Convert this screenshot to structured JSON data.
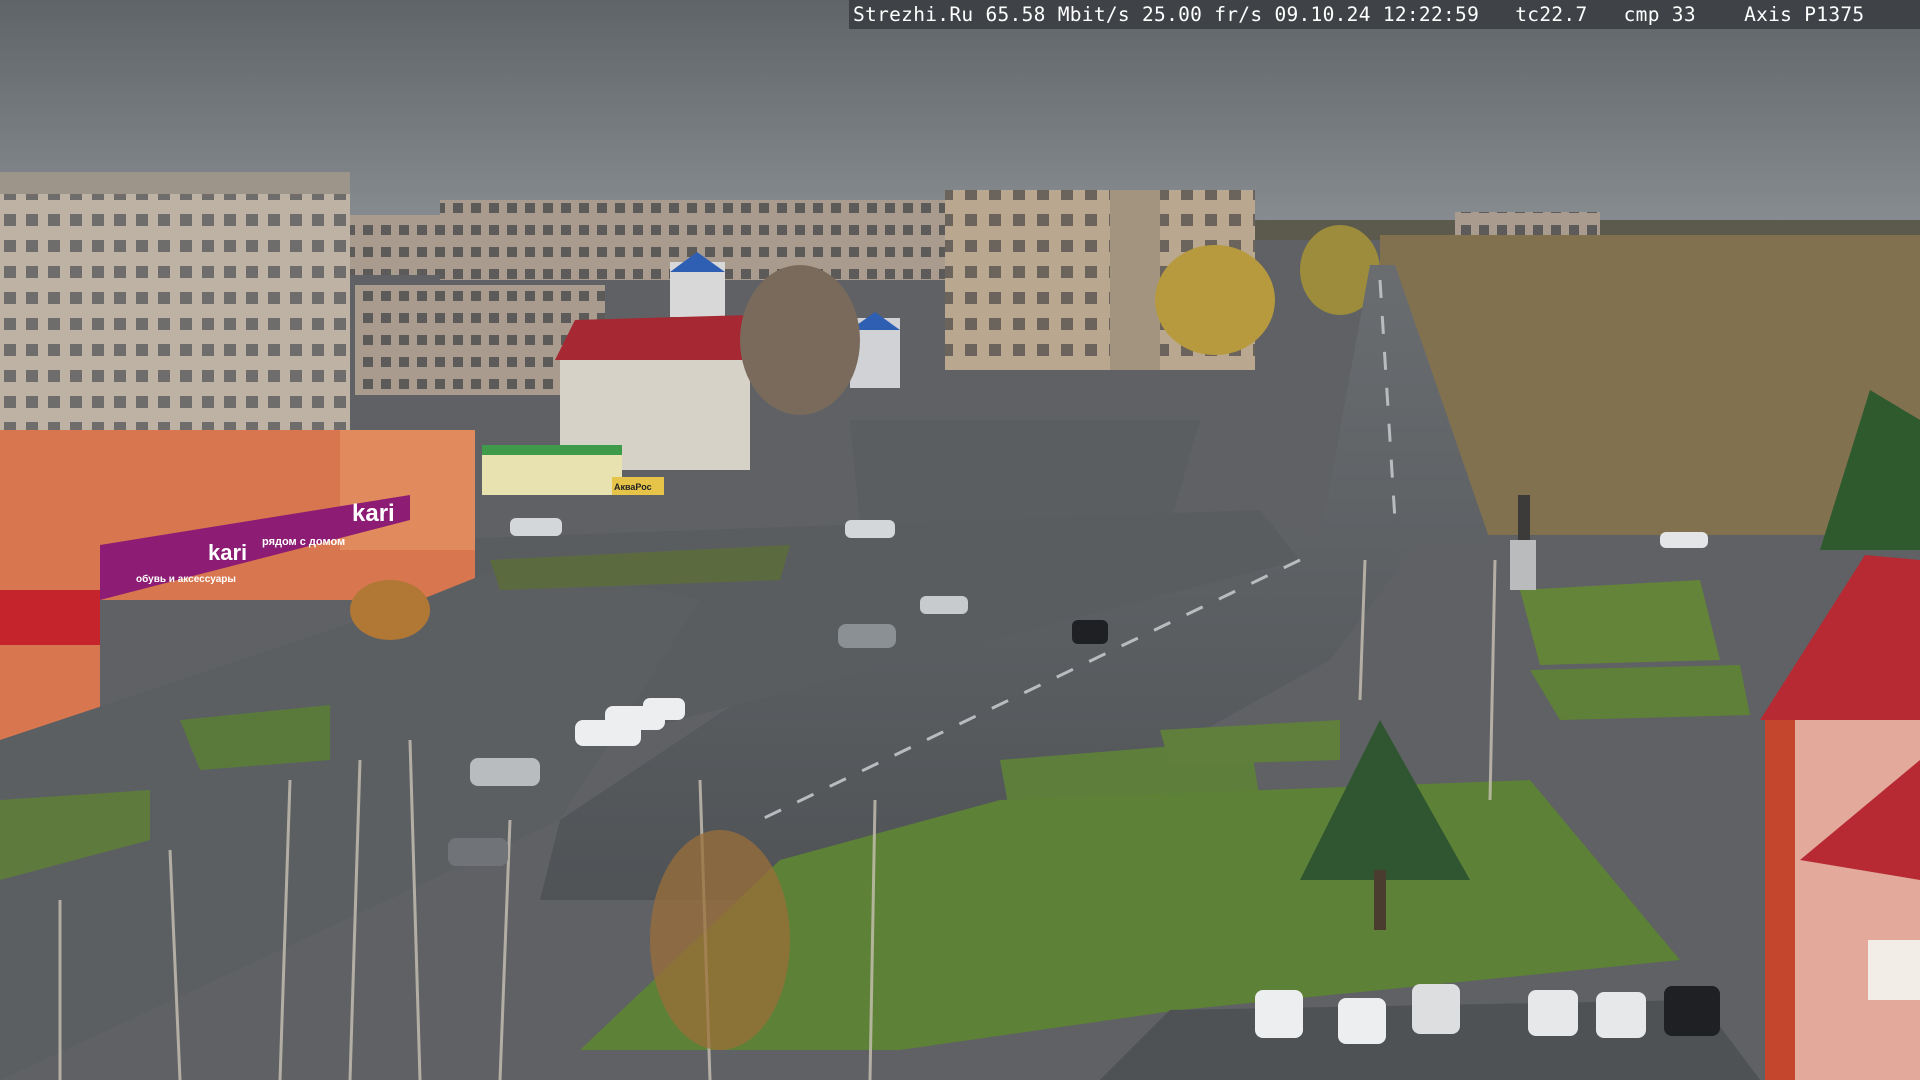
{
  "overlay": {
    "site": "Strezhi.Ru",
    "bitrate": "65.58 Mbit/s",
    "framerate": "25.00 fr/s",
    "date": "09.10.24",
    "time": "12:22:59",
    "tc": "tc22.7",
    "cmp": "cmp 33",
    "camera": "Axis P1375"
  },
  "signs": {
    "store_brand": "kari",
    "store_slogan": "рядом с домом",
    "store_sub": "обувь и аксессуары",
    "store_lower": "kari",
    "pharmacy": "АкваРос"
  },
  "colors": {
    "sky": "#6d7276",
    "kari_magenta": "#8c1c74",
    "store_orange": "#d7764f",
    "red_roof": "#b72a34"
  }
}
